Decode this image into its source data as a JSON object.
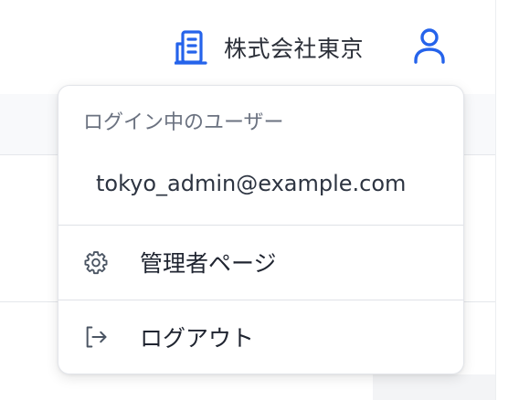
{
  "header": {
    "company_name": "株式会社東京",
    "company_icon": "building-icon",
    "user_icon": "user-icon",
    "accent_color": "#2563eb"
  },
  "user_menu": {
    "section_label": "ログイン中のユーザー",
    "email": "tokyo_admin@example.com",
    "items": [
      {
        "label": "管理者ページ",
        "icon": "gear-icon"
      },
      {
        "label": "ログアウト",
        "icon": "logout-icon"
      }
    ]
  }
}
